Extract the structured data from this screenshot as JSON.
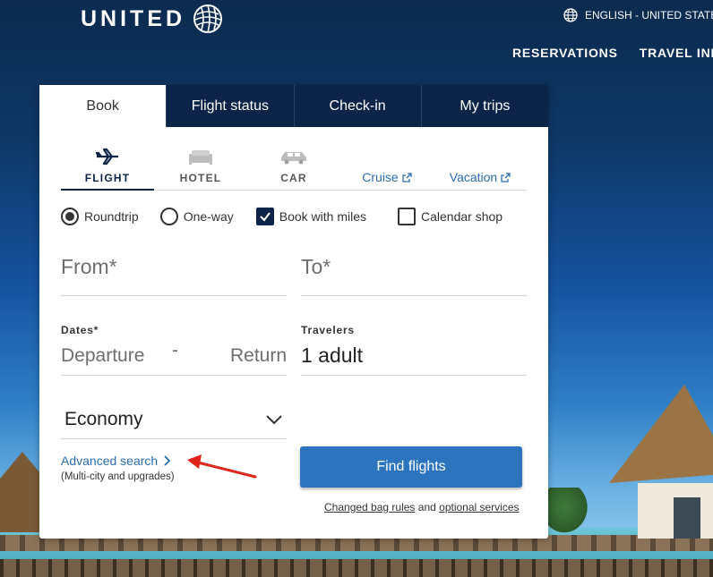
{
  "brand": {
    "name": "UNITED",
    "logo_icon": "globe-logo"
  },
  "language": {
    "label": "ENGLISH - UNITED STATES",
    "icon": "globe-icon"
  },
  "topnav": [
    "RESERVATIONS",
    "TRAVEL INFO"
  ],
  "tabs": [
    {
      "label": "Book",
      "active": true
    },
    {
      "label": "Flight status",
      "active": false
    },
    {
      "label": "Check-in",
      "active": false
    },
    {
      "label": "My trips",
      "active": false
    }
  ],
  "modes": {
    "flight": "FLIGHT",
    "hotel": "HOTEL",
    "car": "CAR",
    "cruise": "Cruise",
    "vacation": "Vacation"
  },
  "trip_options": {
    "roundtrip": "Roundtrip",
    "oneway": "One-way",
    "miles": "Book with miles",
    "calendar": "Calendar shop",
    "selected_trip": "Roundtrip",
    "miles_checked": true,
    "calendar_checked": false
  },
  "from_placeholder": "From*",
  "to_placeholder": "To*",
  "dates": {
    "label": "Dates*",
    "departure_placeholder": "Departure",
    "separator": "-",
    "return_placeholder": "Return"
  },
  "travelers": {
    "label": "Travelers",
    "value": "1 adult"
  },
  "cabin": {
    "value": "Economy"
  },
  "advanced": {
    "link": "Advanced search",
    "sub": "(Multi-city and upgrades)"
  },
  "find_button": "Find flights",
  "bag_info": {
    "link1": "Changed bag rules",
    "joiner": "and",
    "link2": "optional services"
  },
  "colors": {
    "navy": "#0b2447",
    "button": "#2d74bf",
    "link": "#2a6cb0",
    "annotation_arrow": "#e0261b"
  }
}
